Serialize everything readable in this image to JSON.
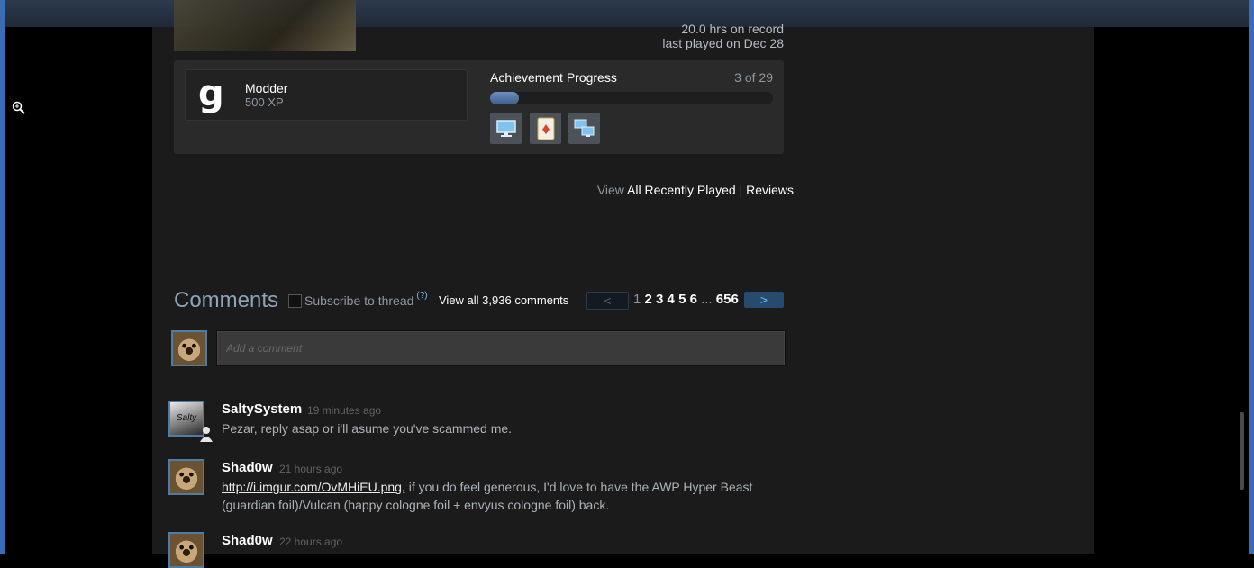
{
  "game": {
    "hours_on_record": "20.0 hrs on record",
    "last_played": "last played on Dec 28"
  },
  "badge": {
    "letter": "g",
    "name": "Modder",
    "xp": "500 XP"
  },
  "achievements": {
    "title": "Achievement Progress",
    "count": "3 of 29",
    "progress_fraction": 0.103,
    "icons": [
      "computer-monitor-icon",
      "playing-card-icon",
      "networked-computers-icon"
    ]
  },
  "view_links": {
    "prefix": "View",
    "all_recently_played": "All Recently Played",
    "separator": "|",
    "reviews": "Reviews"
  },
  "comments": {
    "title": "Comments",
    "subscribe_label": "Subscribe to thread",
    "subscribe_help": "(?)",
    "view_all": "View all 3,936 comments",
    "pager": {
      "prev": "<",
      "current": "1",
      "pages": [
        "2",
        "3",
        "4",
        "5",
        "6"
      ],
      "ellipsis": "...",
      "last": "656",
      "next": ">"
    },
    "input_placeholder": "Add a comment",
    "items": [
      {
        "author": "SaltySystem",
        "time": "19 minutes ago",
        "text": "Pezar, reply asap or i'll asume you've scammed me.",
        "avatar": "Salty"
      },
      {
        "author": "Shad0w",
        "time": "21 hours ago",
        "link": "http://i.imgur.com/OvMHiEU.png,",
        "text": " if you do feel generous, I'd love to have the AWP Hyper Beast (guardian foil)/Vulcan (happy cologne foil + envyus cologne foil) back."
      },
      {
        "author": "Shad0w",
        "time": "22 hours ago"
      }
    ]
  },
  "colors": {
    "frame": "#3a6db5",
    "accent_blue": "#66c0f4",
    "background": "#1b1b1b"
  }
}
